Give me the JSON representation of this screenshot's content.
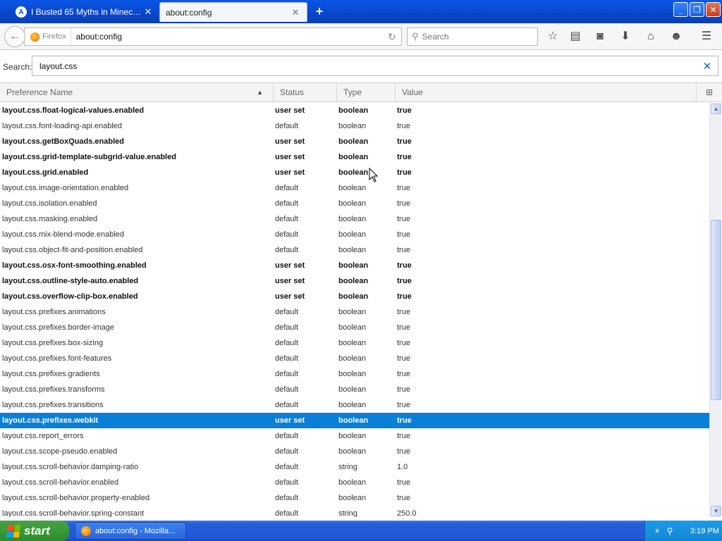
{
  "tabs": [
    {
      "title": "I Busted 65 Myths in Minecraf...",
      "favicon": "A"
    },
    {
      "title": "about:config"
    }
  ],
  "nav": {
    "identity_label": "Firefox",
    "url": "about:config",
    "search_placeholder": "Search"
  },
  "filter": {
    "label": "Search:",
    "value": "layout.css"
  },
  "columns": {
    "name": "Preference Name",
    "status": "Status",
    "type": "Type",
    "value": "Value"
  },
  "rows": [
    {
      "name": "layout.css.float-logical-values.enabled",
      "status": "user set",
      "type": "boolean",
      "value": "true"
    },
    {
      "name": "layout.css.font-loading-api.enabled",
      "status": "default",
      "type": "boolean",
      "value": "true"
    },
    {
      "name": "layout.css.getBoxQuads.enabled",
      "status": "user set",
      "type": "boolean",
      "value": "true"
    },
    {
      "name": "layout.css.grid-template-subgrid-value.enabled",
      "status": "user set",
      "type": "boolean",
      "value": "true"
    },
    {
      "name": "layout.css.grid.enabled",
      "status": "user set",
      "type": "boolean",
      "value": "true"
    },
    {
      "name": "layout.css.image-orientation.enabled",
      "status": "default",
      "type": "boolean",
      "value": "true"
    },
    {
      "name": "layout.css.isolation.enabled",
      "status": "default",
      "type": "boolean",
      "value": "true"
    },
    {
      "name": "layout.css.masking.enabled",
      "status": "default",
      "type": "boolean",
      "value": "true"
    },
    {
      "name": "layout.css.mix-blend-mode.enabled",
      "status": "default",
      "type": "boolean",
      "value": "true"
    },
    {
      "name": "layout.css.object-fit-and-position.enabled",
      "status": "default",
      "type": "boolean",
      "value": "true"
    },
    {
      "name": "layout.css.osx-font-smoothing.enabled",
      "status": "user set",
      "type": "boolean",
      "value": "true"
    },
    {
      "name": "layout.css.outline-style-auto.enabled",
      "status": "user set",
      "type": "boolean",
      "value": "true"
    },
    {
      "name": "layout.css.overflow-clip-box.enabled",
      "status": "user set",
      "type": "boolean",
      "value": "true"
    },
    {
      "name": "layout.css.prefixes.animations",
      "status": "default",
      "type": "boolean",
      "value": "true"
    },
    {
      "name": "layout.css.prefixes.border-image",
      "status": "default",
      "type": "boolean",
      "value": "true"
    },
    {
      "name": "layout.css.prefixes.box-sizing",
      "status": "default",
      "type": "boolean",
      "value": "true"
    },
    {
      "name": "layout.css.prefixes.font-features",
      "status": "default",
      "type": "boolean",
      "value": "true"
    },
    {
      "name": "layout.css.prefixes.gradients",
      "status": "default",
      "type": "boolean",
      "value": "true"
    },
    {
      "name": "layout.css.prefixes.transforms",
      "status": "default",
      "type": "boolean",
      "value": "true"
    },
    {
      "name": "layout.css.prefixes.transitions",
      "status": "default",
      "type": "boolean",
      "value": "true"
    },
    {
      "name": "layout.css.prefixes.webkit",
      "status": "user set",
      "type": "boolean",
      "value": "true",
      "selected": true
    },
    {
      "name": "layout.css.report_errors",
      "status": "default",
      "type": "boolean",
      "value": "true"
    },
    {
      "name": "layout.css.scope-pseudo.enabled",
      "status": "default",
      "type": "boolean",
      "value": "true"
    },
    {
      "name": "layout.css.scroll-behavior.damping-ratio",
      "status": "default",
      "type": "string",
      "value": "1.0"
    },
    {
      "name": "layout.css.scroll-behavior.enabled",
      "status": "default",
      "type": "boolean",
      "value": "true"
    },
    {
      "name": "layout.css.scroll-behavior.property-enabled",
      "status": "default",
      "type": "boolean",
      "value": "true"
    },
    {
      "name": "layout.css.scroll-behavior.spring-constant",
      "status": "default",
      "type": "string",
      "value": "250.0"
    }
  ],
  "taskbar": {
    "start_label": "start",
    "task_title": "about:config - Mozilla...",
    "clock": "3:19 PM"
  },
  "colors": {
    "selection": "#0a7fd8",
    "titlebar": "#0a4fd6",
    "start_green": "#379a37"
  },
  "icons": {
    "toolbar": [
      "star-icon",
      "reading-list-icon",
      "pocket-icon",
      "download-icon",
      "home-icon",
      "smiley-icon",
      "menu-icon"
    ]
  }
}
